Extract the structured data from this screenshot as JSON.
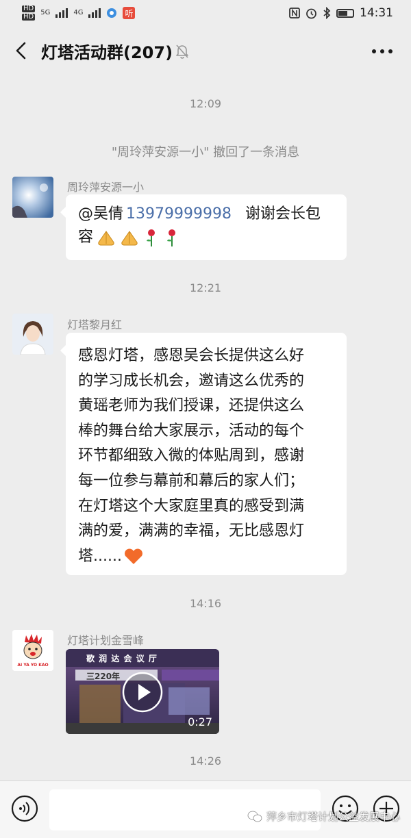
{
  "status_bar": {
    "network_labels": [
      "HD",
      "5G",
      "4G"
    ],
    "app_badge": "听",
    "time": "14:31"
  },
  "header": {
    "title": "灯塔活动群(207)"
  },
  "messages": [
    {
      "type": "timestamp",
      "text": "12:09"
    },
    {
      "type": "system",
      "text": "\"周玲萍安源一小\" 撤回了一条消息"
    },
    {
      "type": "text",
      "sender": "周玲萍安源一小",
      "mention": "@吴倩",
      "phone": "13979999998",
      "line1_rest": "谢谢会长包",
      "line2": "容"
    },
    {
      "type": "timestamp",
      "text": "12:21"
    },
    {
      "type": "text",
      "sender": "灯塔黎月红",
      "lines": [
        "感恩灯塔，感恩吴会长提供这么好",
        "的学习成长机会，邀请这么优秀的",
        "黄瑶老师为我们授课，还提供这么",
        "棒的舞台给大家展示，活动的每个",
        "环节都细致入微的体贴周到，感谢",
        "每一位参与幕前和幕后的家人们；",
        "在灯塔这个大家庭里真的感受到满",
        "满的爱，满满的幸福，无比感恩灯",
        "塔......"
      ]
    },
    {
      "type": "timestamp",
      "text": "14:16"
    },
    {
      "type": "video",
      "sender": "灯塔计划金雪峰",
      "duration": "0:27",
      "sign_text": "三220年",
      "sign_top": "歌 润 达 会 议 厅",
      "avatar_text": "AI YA YO KAO"
    },
    {
      "type": "timestamp",
      "text": "14:26"
    }
  ],
  "watermark": "萍乡市灯塔计划公益发展中心",
  "icons": [
    "back-icon",
    "mute-icon",
    "more-icon",
    "voice-icon",
    "emoji-icon",
    "add-icon",
    "play-icon",
    "heart-emoji",
    "pray-emoji",
    "rose-emoji"
  ],
  "colors": {
    "background": "#ededed",
    "bubble": "#ffffff",
    "mention": "#4a6ea8",
    "meta": "#8a8a8a"
  }
}
